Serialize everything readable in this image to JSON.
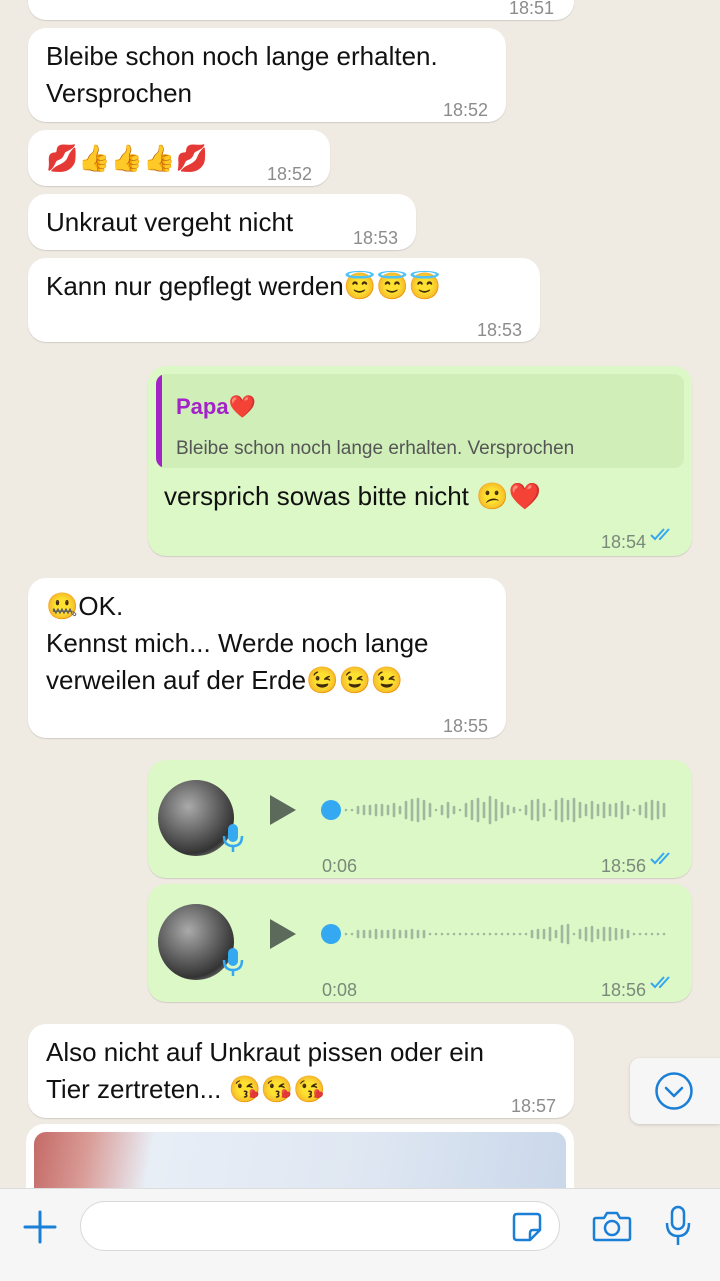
{
  "messages": [
    {
      "text": "",
      "time": "18:51"
    },
    {
      "text_line1": "Bleibe schon noch lange erhalten.",
      "text_line2": "Versprochen",
      "time": "18:52"
    },
    {
      "text": "💋👍👍👍💋",
      "time": "18:52"
    },
    {
      "text": "Unkraut vergeht nicht",
      "time": "18:53"
    },
    {
      "text": "Kann nur gepflegt werden😇😇😇",
      "time": "18:53"
    },
    {
      "quote_author": "Papa❤️",
      "quote_text": "Bleibe schon noch lange erhalten. Versprochen",
      "text": "versprich sowas bitte nicht 😕❤️",
      "time": "18:54"
    },
    {
      "text_line1": "🤐OK.",
      "text_line2": "Kennst mich... Werde noch lange",
      "text_line3": "verweilen auf der Erde😉😉😉",
      "time": "18:55"
    },
    {
      "duration": "0:06",
      "time": "18:56"
    },
    {
      "duration": "0:08",
      "time": "18:56"
    },
    {
      "text_line1": "Also nicht auf Unkraut pissen oder ein",
      "text_line2": "Tier zertreten... 😘😘😘",
      "time": "18:57"
    }
  ],
  "colors": {
    "background": "#efeae2",
    "incoming_bubble": "#ffffff",
    "outgoing_bubble": "#dcf8c6",
    "read_ticks": "#34a8f0",
    "quote_accent": "#a323c9",
    "icon_blue": "#1a7fd6"
  },
  "icons": {
    "read_receipt": "double-check-icon",
    "play": "play-icon",
    "voice_badge": "microphone-icon",
    "scroll_down": "chevron-down-circle-icon",
    "attach": "plus-icon",
    "sticker": "sticker-icon",
    "camera": "camera-icon",
    "mic": "microphone-icon"
  }
}
